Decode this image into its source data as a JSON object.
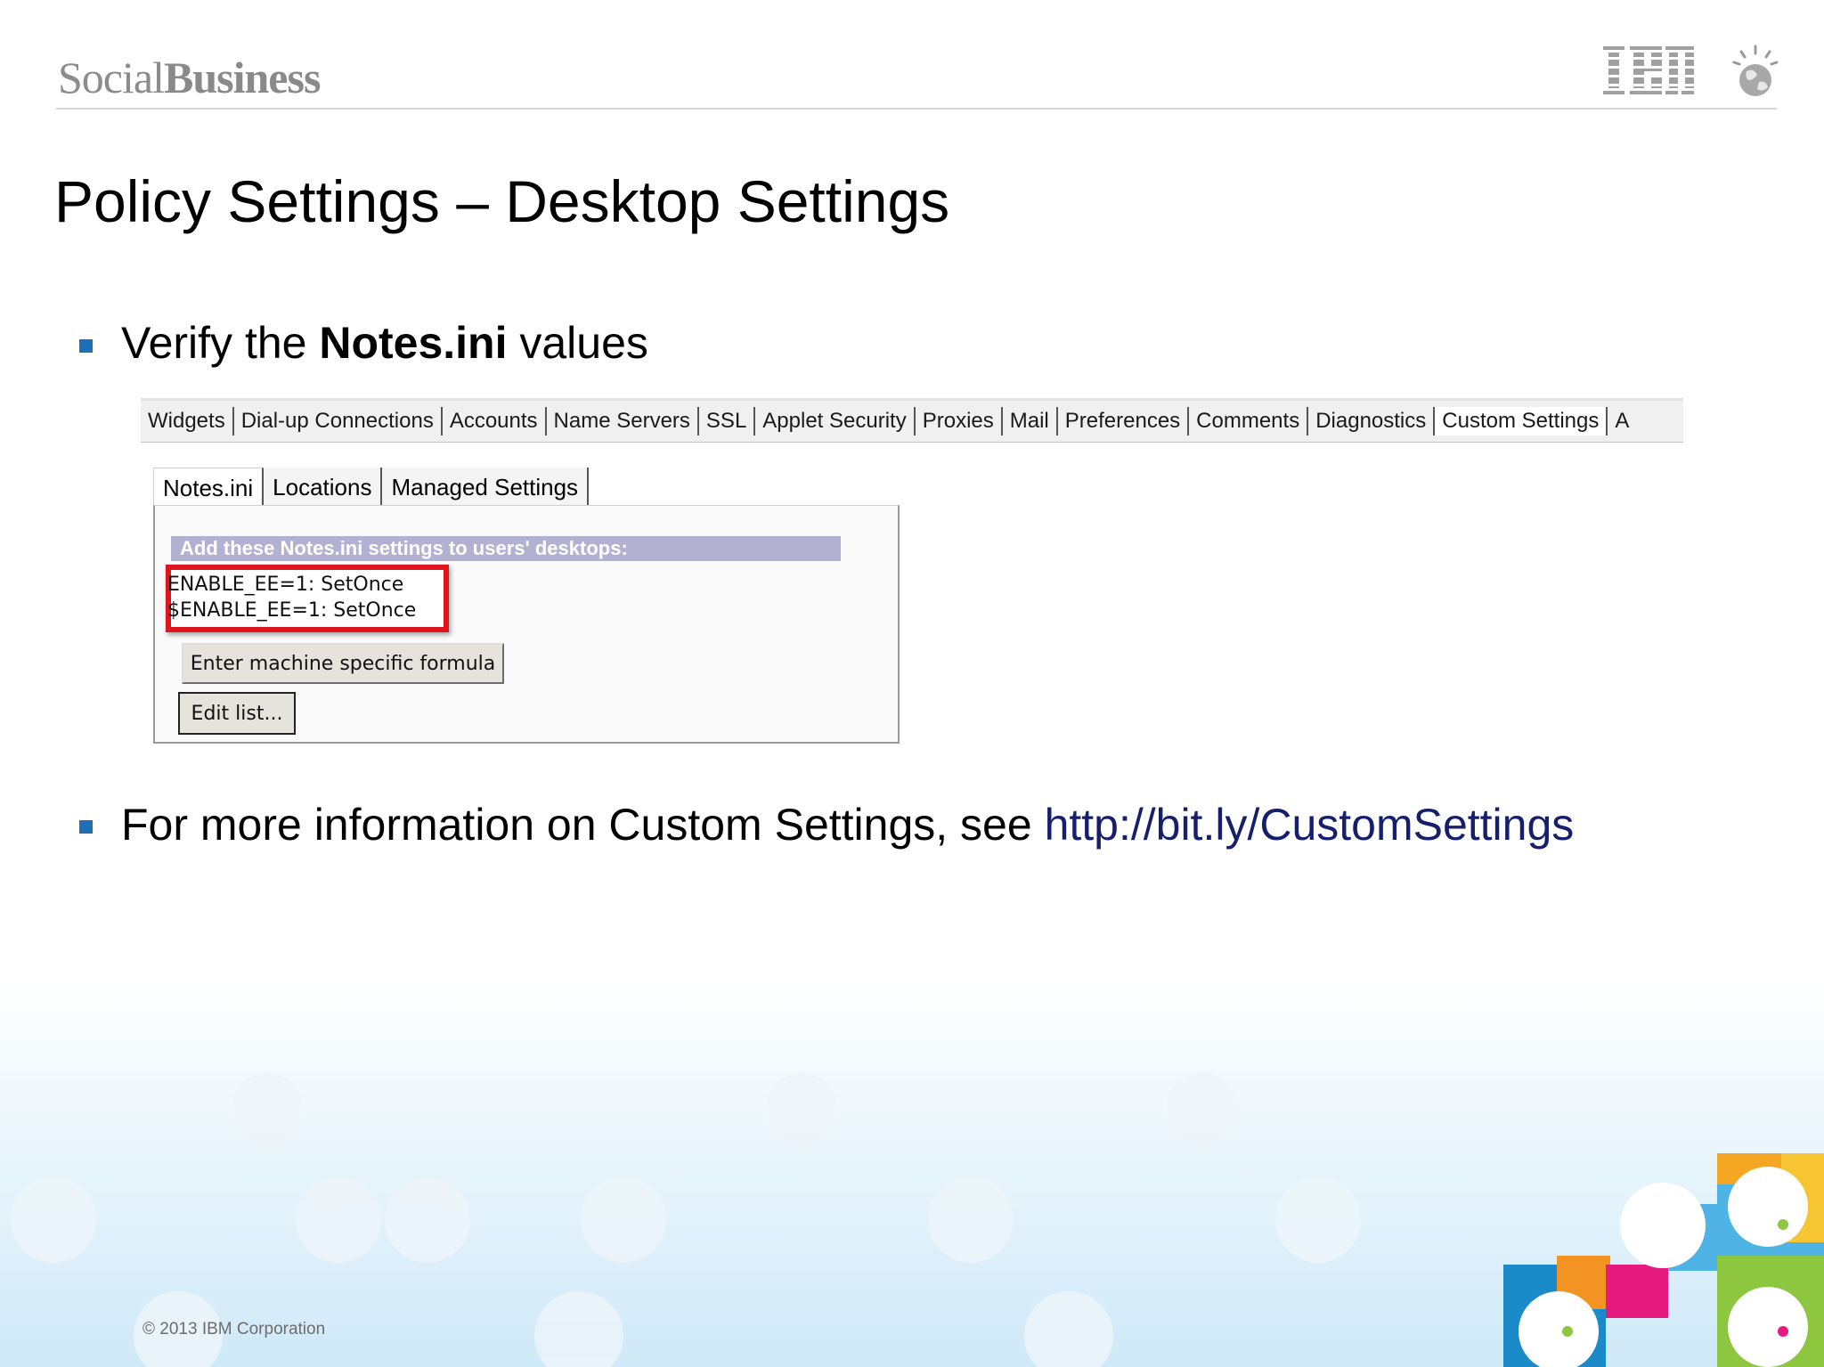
{
  "header": {
    "brand_part1": "Social",
    "brand_part2": "Business",
    "logo_text": "IBM"
  },
  "title": "Policy Settings – Desktop Settings",
  "bullets": [
    {
      "pre": "Verify the ",
      "bold": "Notes.ini",
      "post": " values"
    },
    {
      "pre": "For more information on Custom Settings, see ",
      "link": "http://bit.ly/CustomSettings"
    }
  ],
  "dialog": {
    "tabs": [
      "Widgets",
      "Dial-up Connections",
      "Accounts",
      "Name Servers",
      "SSL",
      "Applet Security",
      "Proxies",
      "Mail",
      "Preferences",
      "Comments",
      "Diagnostics",
      "Custom Settings",
      "A"
    ],
    "active_tab": "Custom Settings",
    "subtabs": [
      "Notes.ini",
      "Locations",
      "Managed Settings"
    ],
    "active_subtab": "Notes.ini",
    "panel_header": "Add these Notes.ini settings to users' desktops:",
    "ini_lines": [
      "ENABLE_EE=1: SetOnce",
      "$ENABLE_EE=1: SetOnce"
    ],
    "formula_button": "Enter machine specific formula",
    "edit_button": "Edit list..."
  },
  "footer": {
    "copyright": "© 2013 IBM Corporation"
  },
  "colors": {
    "bullet": "#1f6fb8",
    "link": "#151f6b",
    "highlight": "#e0141c",
    "panel_header": "#b3b1d2"
  }
}
